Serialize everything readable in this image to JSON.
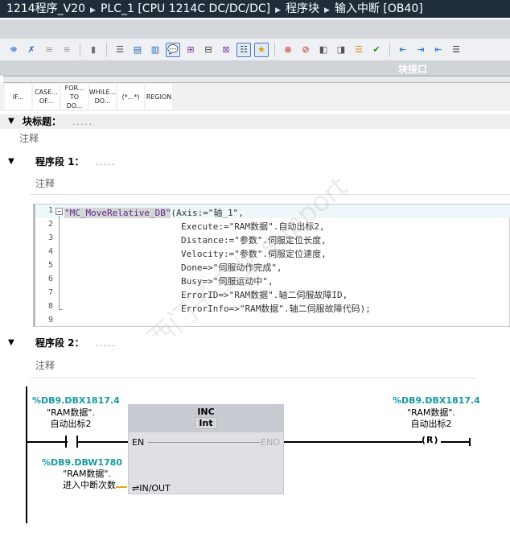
{
  "title": {
    "project": "1214程序_V20",
    "plc": "PLC_1 [CPU 1214C DC/DC/DC]",
    "folder": "程序块",
    "block": "输入中断 [OB40]"
  },
  "toolbar": {
    "icons": [
      "insert-network-icon",
      "delete-network-icon",
      "insert-row-icon",
      "add-row-icon",
      "reset-start-icon",
      "indent-icon",
      "all-networks-icon",
      "network-collapse-icon",
      "comments-icon",
      "display-absolute-icon",
      "display-symbolic-icon",
      "tag-info-icon",
      "free-comments-icon",
      "favorites-icon",
      "clear-errors-icon",
      "go-to-error-icon",
      "monitor-icon",
      "force-icon",
      "call-hierarchy-icon",
      "compile-check-icon",
      "outdent-icon",
      "indent-right-icon",
      "indent-left-icon",
      "more-icon"
    ]
  },
  "interface_label": "块接口",
  "templates": [
    "IF...",
    "CASE... OF...",
    "FOR... TO DO...",
    "WHILE... DO...",
    "(*...*)",
    "REGION"
  ],
  "block_title": {
    "label": "块标题：",
    "dots": ".....",
    "comment": "注释"
  },
  "network1": {
    "label": "程序段 1：",
    "dots": ".....",
    "comment": "注释",
    "lines": [
      "1",
      "2",
      "3",
      "4",
      "5",
      "6",
      "7",
      "8",
      "9"
    ],
    "code": [
      "\"MC_MoveRelative_DB\"",
      "(Axis:=\"轴_1\",",
      "Execute:=\"RAM数据\".自动出标2,",
      "Distance:=\"参数\".伺服定位长度,",
      "Velocity:=\"参数\".伺服定位速度,",
      "Done=>\"伺服动作完成\",",
      "Busy=>\"伺服运动中\",",
      "ErrorID=>\"RAM数据\".轴二伺服故障ID,",
      "ErrorInfo=>\"RAM数据\".轴二伺服故障代码);"
    ]
  },
  "network2": {
    "label": "程序段 2：",
    "dots": ".....",
    "comment": "注释",
    "contact": {
      "address": "%DB9.DBX1817.4",
      "name1": "\"RAM数据\".",
      "name2": "自动出标2"
    },
    "box": {
      "name": "INC",
      "type": "Int",
      "en": "EN",
      "eno": "ENO",
      "inout": "⇌IN/OUT"
    },
    "inout_operand": {
      "address": "%DB9.DBW1780",
      "name1": "\"RAM数据\".",
      "name2": "进入中断次数"
    },
    "coil": {
      "address": "%DB9.DBX1817.4",
      "name1": "\"RAM数据\".",
      "name2": "自动出标2",
      "type": "R"
    }
  },
  "watermark": "西门子工业支持中心 support.industry.siemens.com/cs",
  "colors": {
    "title_bg": "#1f2d3b",
    "operand": "#159aa0",
    "inout_wire": "#f0a020"
  }
}
